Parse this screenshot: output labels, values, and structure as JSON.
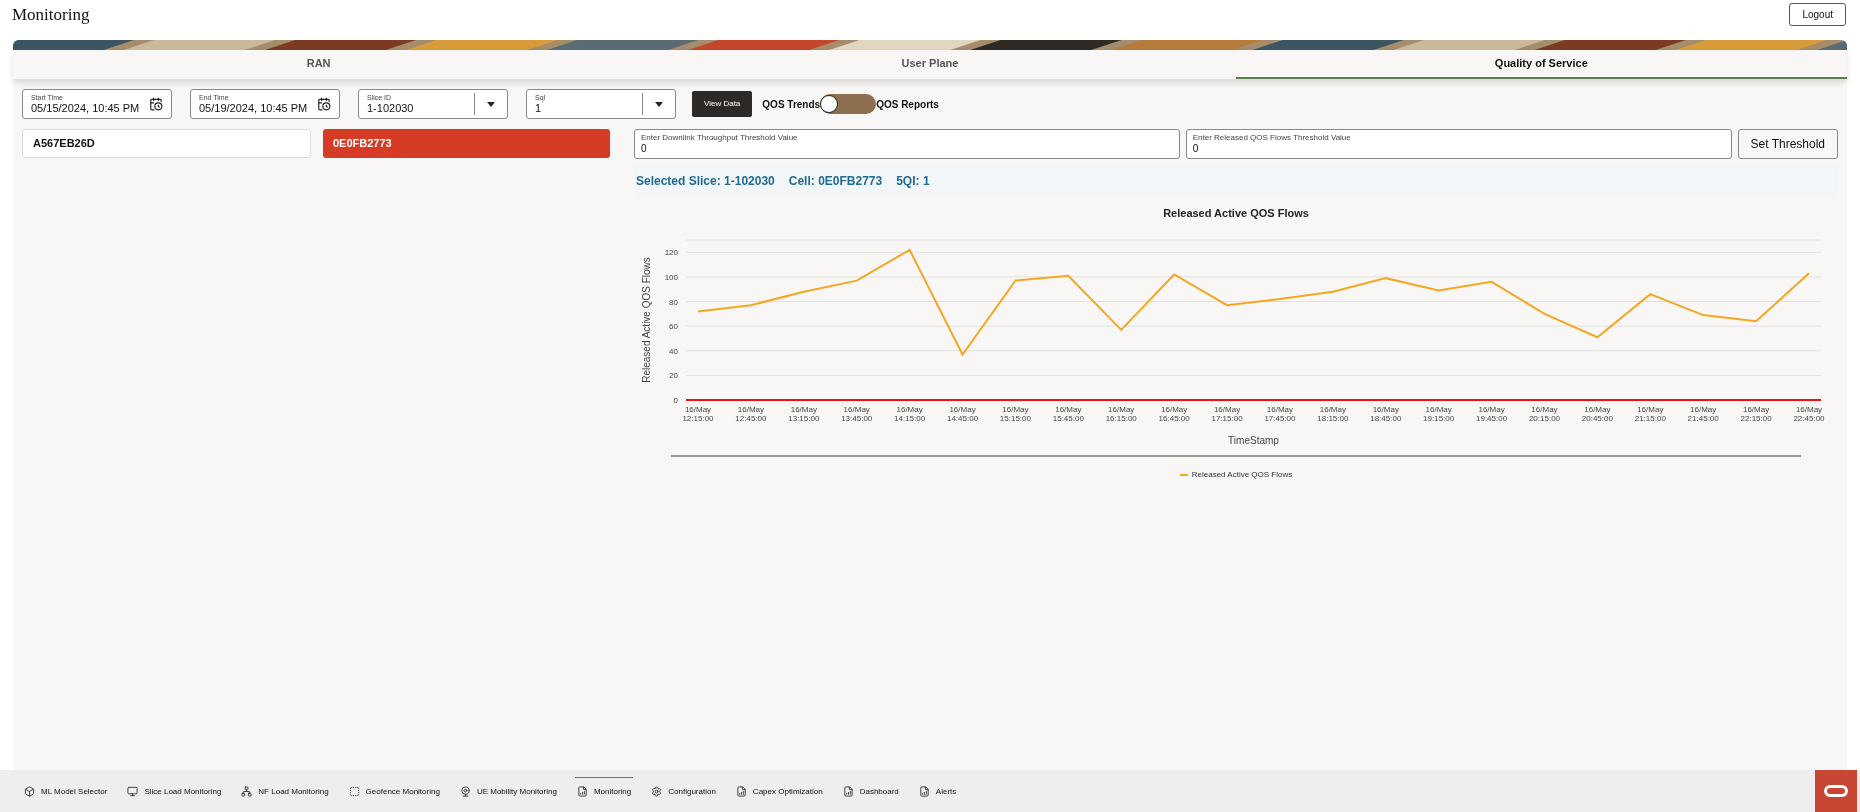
{
  "header": {
    "title": "Monitoring",
    "logout": "Logout"
  },
  "tabs": [
    {
      "label": "RAN",
      "selected": false
    },
    {
      "label": "User Plane",
      "selected": false
    },
    {
      "label": "Quality of Service",
      "selected": true
    }
  ],
  "filters": [
    {
      "kind": "date",
      "label": "Start Time",
      "value": "05/15/2024, 10:45 PM"
    },
    {
      "kind": "date",
      "label": "End Time",
      "value": "05/19/2024, 10:45 PM"
    },
    {
      "kind": "select",
      "label": "Slice ID",
      "value": "1-102030"
    },
    {
      "kind": "select",
      "label": "Sql",
      "value": "1"
    }
  ],
  "view_button": "View Data",
  "toggle": {
    "left_label": "QOS Trends",
    "right_label": "QOS Reports",
    "on": false
  },
  "cells": [
    {
      "label": "A567EB26D",
      "selected": false
    },
    {
      "label": "0E0FB2773",
      "selected": true
    }
  ],
  "thresholds": [
    {
      "label": "Enter Downlink Throughput Threshold Value",
      "value": "0"
    },
    {
      "label": "Enter Released QOS Flows Threshold Value",
      "value": "0"
    }
  ],
  "set_threshold": "Set Threshold",
  "selection": [
    {
      "label": "Selected Slice:",
      "value": "1-102030"
    },
    {
      "label": "Cell:",
      "value": "0E0FB2773"
    },
    {
      "label": "5QI:",
      "value": "1"
    }
  ],
  "chart_data": {
    "type": "line",
    "title": "Released Active QOS Flows",
    "xlabel": "TimeStamp",
    "ylabel": "Released Active QOS Flows",
    "categories": [
      "16/May 12:15:00",
      "16/May 12:45:00",
      "16/May 13:15:00",
      "16/May 13:45:00",
      "16/May 14:15:00",
      "16/May 14:45:00",
      "16/May 15:15:00",
      "16/May 15:45:00",
      "16/May 16:15:00",
      "16/May 16:45:00",
      "16/May 17:15:00",
      "16/May 17:45:00",
      "16/May 18:15:00",
      "16/May 18:45:00",
      "16/May 19:15:00",
      "16/May 19:45:00",
      "16/May 20:15:00",
      "16/May 20:45:00",
      "16/May 21:15:00",
      "16/May 21:45:00",
      "16/May 22:15:00",
      "16/May 22:45:00"
    ],
    "series": [
      {
        "name": "Released Active QOS Flows",
        "color": "#f5a623",
        "values": [
          72,
          77,
          88,
          97,
          122,
          37,
          97,
          101,
          57,
          102,
          77,
          82,
          88,
          99,
          89,
          96,
          70,
          51,
          86,
          69,
          64,
          103
        ]
      }
    ],
    "ylim": [
      0,
      130
    ],
    "yticks": [
      0,
      20,
      40,
      60,
      80,
      100,
      120
    ],
    "grid": true
  },
  "footer_nav": [
    {
      "label": "ML Model Selector",
      "selected": false
    },
    {
      "label": "Slice Load Monitoring",
      "selected": false
    },
    {
      "label": "NF Load Monitoring",
      "selected": false
    },
    {
      "label": "Geofence Monitoring",
      "selected": false
    },
    {
      "label": "UE Mobility Monitoring",
      "selected": false
    },
    {
      "label": "Monitoring",
      "selected": true
    },
    {
      "label": "Configuration",
      "selected": false
    },
    {
      "label": "Capex Optimization",
      "selected": false
    },
    {
      "label": "Dashboard",
      "selected": false
    },
    {
      "label": "Alerts",
      "selected": false
    }
  ]
}
